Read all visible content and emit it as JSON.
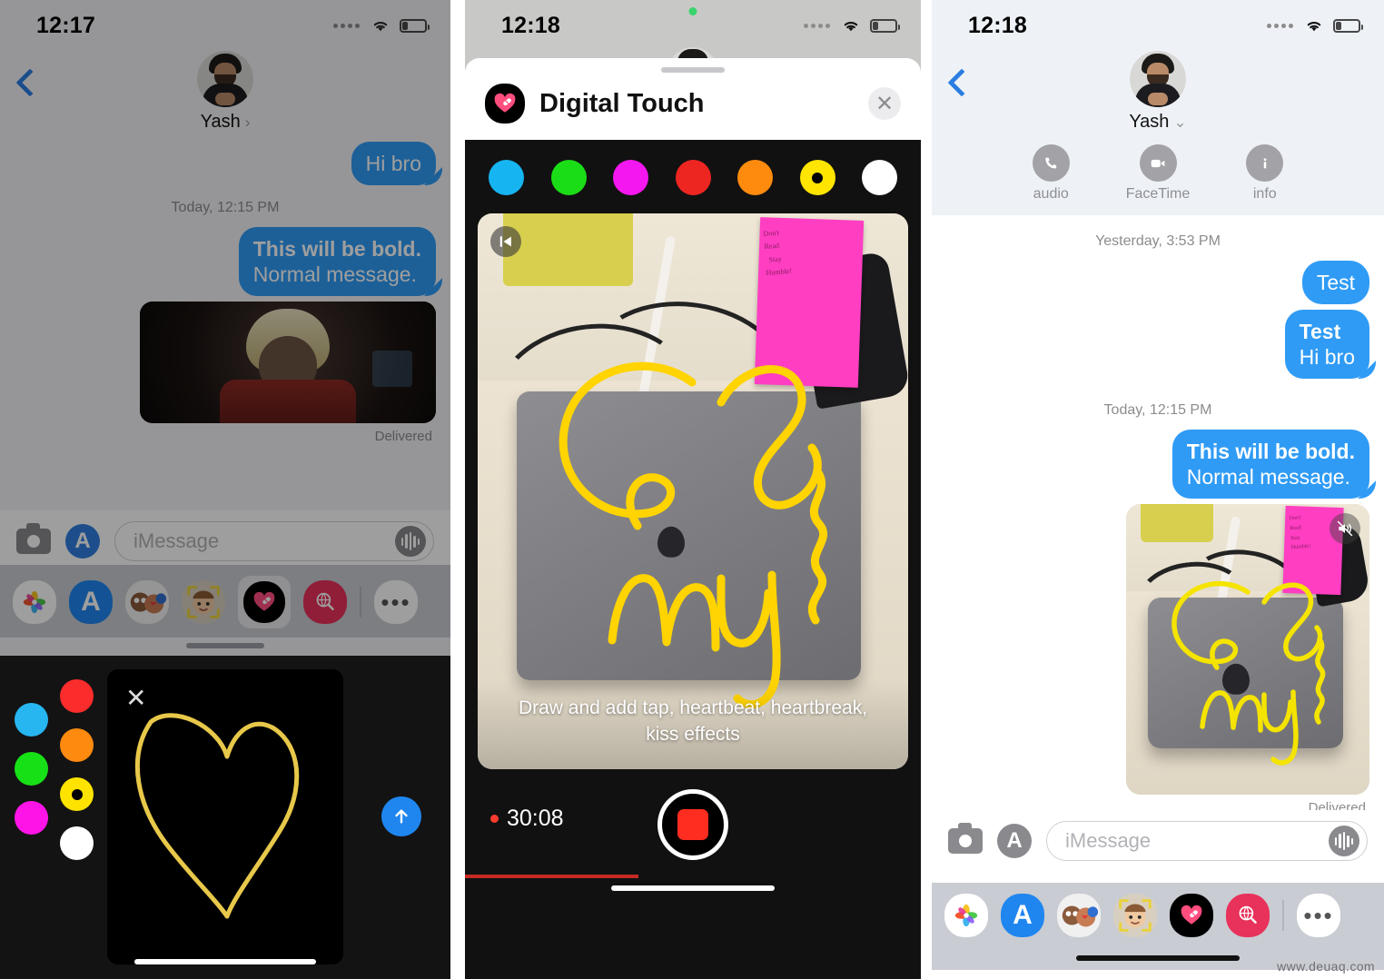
{
  "panel1": {
    "status": {
      "time": "12:17",
      "wifi_icon": "wifi-icon",
      "battery_icon": "battery-low-icon"
    },
    "header": {
      "contact_name": "Yash",
      "chevron": "›",
      "back_icon": "back-chevron-icon"
    },
    "messages": [
      {
        "id": "m1",
        "text": "Hi bro",
        "align": "out",
        "style": "normal"
      }
    ],
    "daystamp": "Today, 12:15 PM",
    "bubble_bold_line": "This will be bold.",
    "bubble_normal_line": "Normal message.",
    "delivered_label": "Delivered",
    "input": {
      "placeholder": "iMessage",
      "camera_icon": "camera-icon",
      "appstore_icon": "app-store-icon",
      "audio_icon": "audio-waveform-icon"
    },
    "appdrawer": [
      {
        "name": "photos",
        "label": "Photos"
      },
      {
        "name": "app-store",
        "label": "App Store"
      },
      {
        "name": "memoji-stickers",
        "label": "Memoji Stickers"
      },
      {
        "name": "animoji",
        "label": "Animoji"
      },
      {
        "name": "digital-touch",
        "label": "Digital Touch",
        "selected": true
      },
      {
        "name": "image-search",
        "label": "#images"
      },
      {
        "name": "more",
        "label": "•••"
      }
    ],
    "digital_touch": {
      "close_icon": "close-x-icon",
      "send_icon": "send-arrow-up-icon",
      "drawing": "yellow-heart-sketch",
      "palette": [
        {
          "name": "red",
          "hex": "#FB2C2C",
          "selected": false
        },
        {
          "name": "blue",
          "hex": "#27B6F0",
          "selected": false
        },
        {
          "name": "orange",
          "hex": "#FF8A10",
          "selected": false
        },
        {
          "name": "green",
          "hex": "#17E017",
          "selected": false
        },
        {
          "name": "yellow",
          "hex": "#FFE300",
          "selected": true
        },
        {
          "name": "magenta",
          "hex": "#FF14E8",
          "selected": false
        },
        {
          "name": "white",
          "hex": "#FFFFFF",
          "selected": false
        }
      ]
    }
  },
  "panel2": {
    "status": {
      "time": "12:18",
      "recording_dot": true,
      "wifi_icon": "wifi-icon",
      "battery_icon": "battery-low-icon"
    },
    "sheet": {
      "title": "Digital Touch",
      "app_icon": "digital-touch-icon",
      "close_icon": "close-x-icon",
      "grabber": "sheet-grabber"
    },
    "palette": [
      {
        "name": "blue",
        "hex": "#16B4F0",
        "selected": false
      },
      {
        "name": "green",
        "hex": "#1BDD17",
        "selected": false
      },
      {
        "name": "magenta",
        "hex": "#F517F0",
        "selected": false
      },
      {
        "name": "red",
        "hex": "#EE2622",
        "selected": false
      },
      {
        "name": "orange",
        "hex": "#FF8B0E",
        "selected": false
      },
      {
        "name": "yellow",
        "hex": "#FFE500",
        "selected": true
      },
      {
        "name": "white",
        "hex": "#FFFFFF",
        "selected": false
      }
    ],
    "viewer": {
      "rewind_icon": "rewind-to-start-icon",
      "hint_line1": "Draw and add tap, heartbeat, heartbreak,",
      "hint_line2": "kiss effects"
    },
    "recording": {
      "timer": "30:08",
      "stop_icon": "stop-record-icon",
      "progress_percent": 38
    }
  },
  "panel3": {
    "status": {
      "time": "12:18",
      "wifi_icon": "wifi-icon",
      "battery_icon": "battery-low-icon"
    },
    "header": {
      "contact_name": "Yash",
      "chevron": "⌄",
      "back_icon": "back-chevron-icon",
      "actions": [
        {
          "name": "audio",
          "label": "audio",
          "icon": "phone-icon"
        },
        {
          "name": "facetime",
          "label": "FaceTime",
          "icon": "video-camera-icon"
        },
        {
          "name": "info",
          "label": "info",
          "icon": "info-icon"
        }
      ]
    },
    "daystamp_1": "Yesterday, 3:53 PM",
    "messages_1": [
      {
        "text": "Test",
        "align": "out"
      },
      {
        "bold": "Test",
        "normal": "Hi bro",
        "align": "out"
      }
    ],
    "daystamp_2": "Today, 12:15 PM",
    "bubble_bold_line": "This will be bold.",
    "bubble_normal_line": "Normal message.",
    "media": {
      "mute_icon": "speaker-mute-icon",
      "content": "digital-touch-video-yellow-scribble"
    },
    "delivered_label": "Delivered",
    "input": {
      "placeholder": "iMessage",
      "camera_icon": "camera-icon",
      "appstore_icon": "app-store-icon",
      "audio_icon": "audio-waveform-icon"
    },
    "appdrawer": [
      {
        "name": "photos",
        "label": "Photos"
      },
      {
        "name": "app-store",
        "label": "App Store"
      },
      {
        "name": "memoji-stickers",
        "label": "Memoji Stickers"
      },
      {
        "name": "animoji",
        "label": "Animoji"
      },
      {
        "name": "digital-touch",
        "label": "Digital Touch"
      },
      {
        "name": "image-search",
        "label": "#images"
      },
      {
        "name": "more",
        "label": "•••"
      }
    ]
  },
  "watermark": "www.deuaq.com",
  "colors": {
    "imessage_blue": "#2f9bf5",
    "accent_blue": "#1f86f0",
    "record_red": "#ff2d20",
    "drawer_bg": "#c9ccd2",
    "selected_yellow": "#FFE500"
  }
}
